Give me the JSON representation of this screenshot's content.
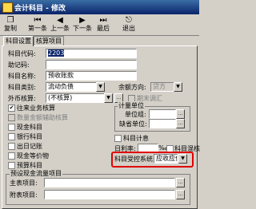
{
  "window": {
    "title": "会计科目 - 修改"
  },
  "toolbar": [
    {
      "label": "复制",
      "icon": "copy-icon",
      "glyph": "❐"
    },
    {
      "label": "第一条",
      "icon": "first-record-icon",
      "glyph": "⏮"
    },
    {
      "label": "上一条",
      "icon": "prev-record-icon",
      "glyph": "◀"
    },
    {
      "label": "下一条",
      "icon": "next-record-icon",
      "glyph": "▶"
    },
    {
      "label": "最后",
      "icon": "last-record-icon",
      "glyph": "⏭"
    },
    {
      "label": "退出",
      "icon": "exit-icon",
      "glyph": "⎋"
    }
  ],
  "tabs": [
    {
      "label": "科目设置"
    },
    {
      "label": "核算项目"
    }
  ],
  "form": {
    "code_label": "科目代码:",
    "code_value": "2203",
    "mnemonic_label": "助记码:",
    "mnemonic_value": "",
    "name_label": "科目名称:",
    "name_value": "预收账款",
    "category_label": "科目类别:",
    "category_value": "流动负债",
    "balance_dir_label": "余额方向:",
    "balance_dir_value": "贷方",
    "currency_label": "外币核算:",
    "currency_value": "(不核算)",
    "period_adjust_label": "期末调汇",
    "checks": [
      {
        "label": "往来业务核算",
        "checked": true,
        "disabled": false
      },
      {
        "label": "数量金额辅助核算",
        "checked": false,
        "disabled": true
      },
      {
        "label": "现金科目",
        "checked": false,
        "disabled": false
      },
      {
        "label": "银行科目",
        "checked": false,
        "disabled": false
      },
      {
        "label": "出日记账",
        "checked": false,
        "disabled": false
      },
      {
        "label": "现金等价物",
        "checked": false,
        "disabled": false
      },
      {
        "label": "预算科目",
        "checked": false,
        "disabled": false
      }
    ],
    "unit_group_title": "计量单位",
    "unit_group_label": "单位组:",
    "unit_default_label": "缺省单位:",
    "subject_calc_label": "科目计息",
    "daily_rate_label": "日利率:",
    "daily_rate_suffix": "‰",
    "mixed_label": "科目混核",
    "control_system_label": "科目受控系统:",
    "control_system_value": "应收应付",
    "cashflow_group_title": "预设现金流量项目",
    "main_item_label": "主表项目:",
    "sub_item_label": "附表项目:"
  }
}
